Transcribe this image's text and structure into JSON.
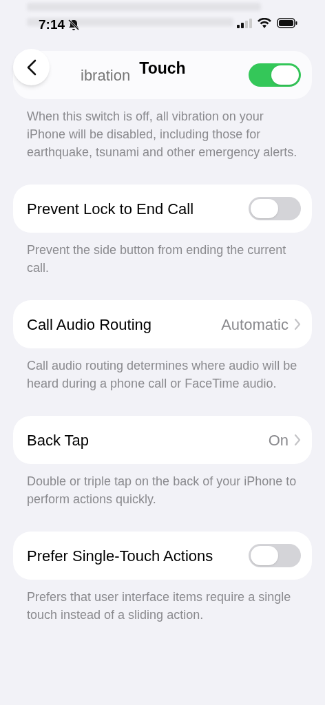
{
  "status_bar": {
    "time": "7:14"
  },
  "nav": {
    "title": "Touch"
  },
  "sections": [
    {
      "kind": "switch",
      "label": "ibration",
      "on": true,
      "faded": true,
      "note": "When this switch is off, all vibration on your iPhone will be disabled, including those for earthquake, tsunami and other emergency alerts."
    },
    {
      "kind": "switch",
      "label": "Prevent Lock to End Call",
      "on": false,
      "faded": false,
      "note": "Prevent the side button from ending the current call."
    },
    {
      "kind": "link",
      "label": "Call Audio Routing",
      "value": "Automatic",
      "faded": false,
      "note": "Call audio routing determines where audio will be heard during a phone call or FaceTime audio."
    },
    {
      "kind": "link",
      "label": "Back Tap",
      "value": "On",
      "faded": false,
      "note": "Double or triple tap on the back of your iPhone to perform actions quickly."
    },
    {
      "kind": "switch",
      "label": "Prefer Single-Touch Actions",
      "on": false,
      "faded": false,
      "note": "Prefers that user interface items require a single touch instead of a sliding action."
    }
  ]
}
